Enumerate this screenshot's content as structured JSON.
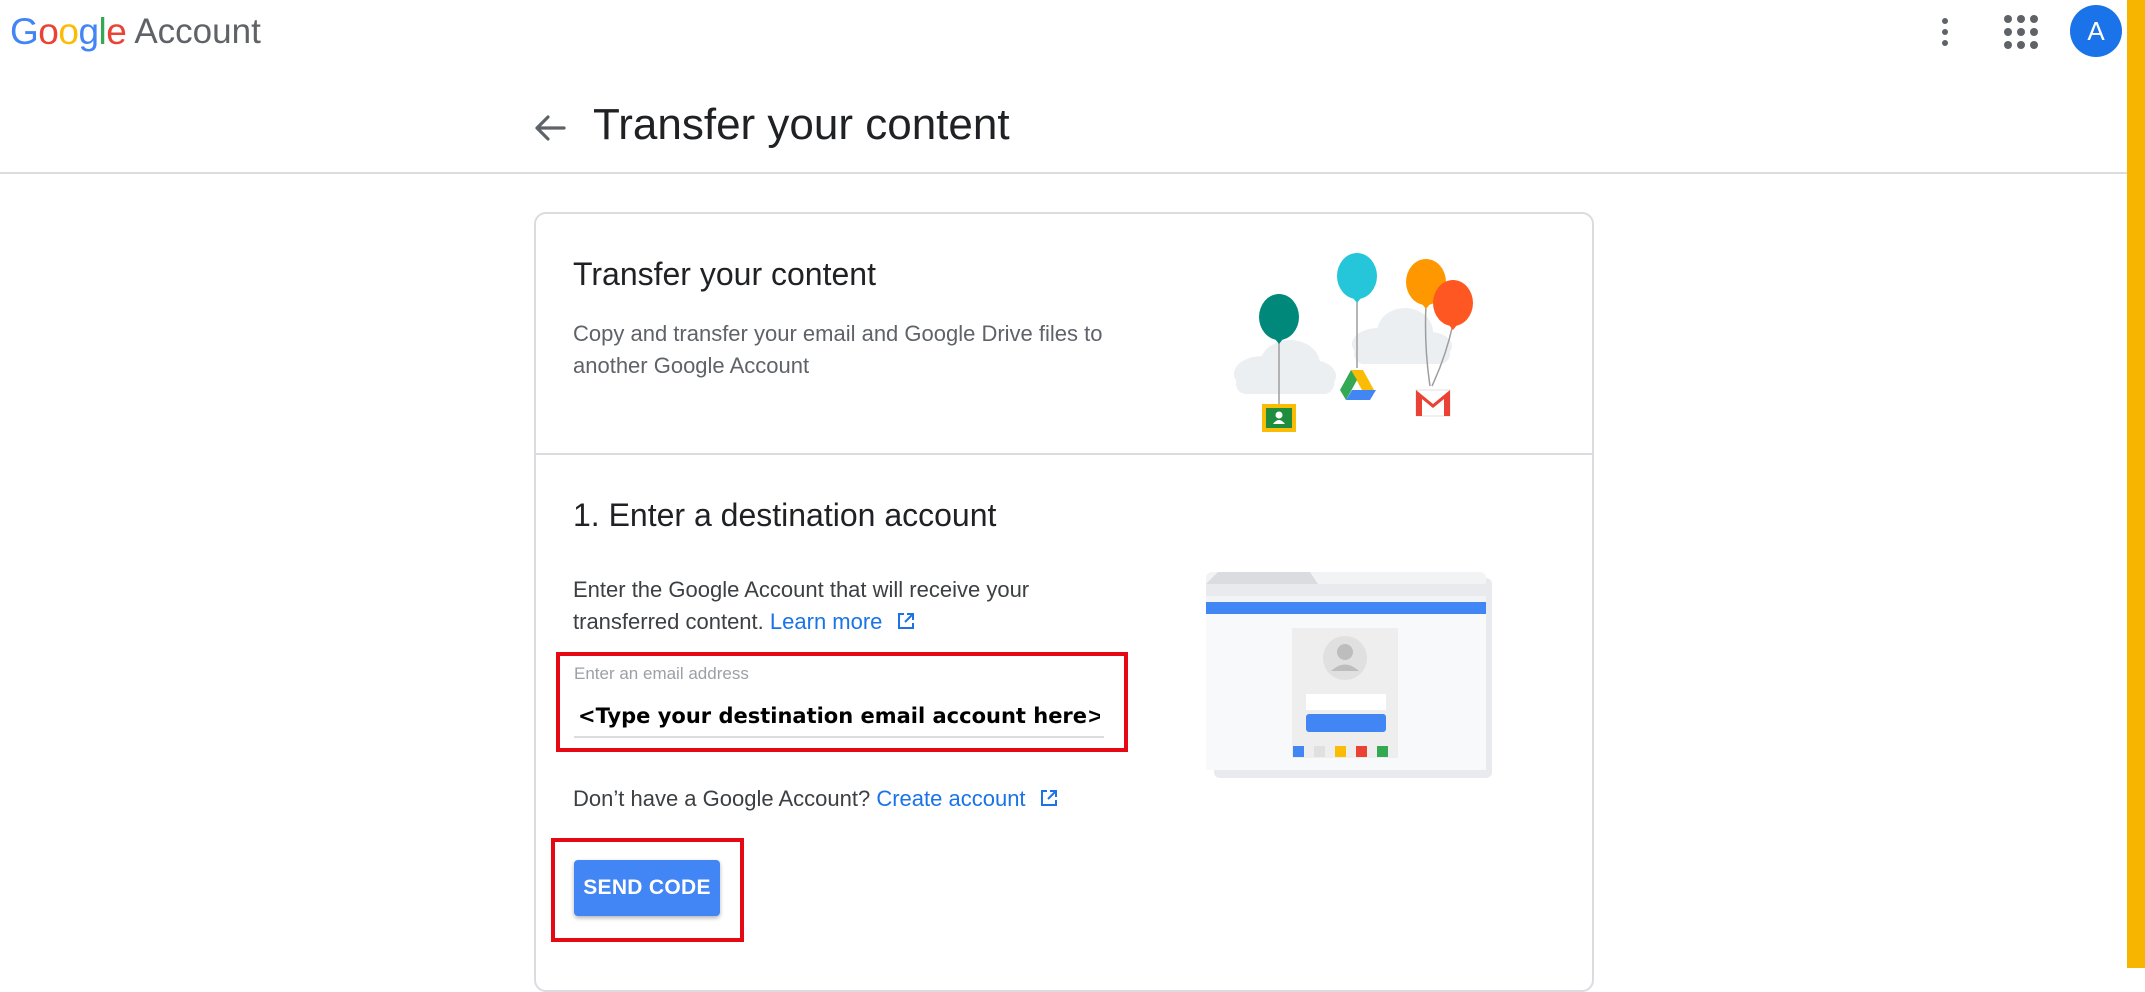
{
  "header": {
    "logo_google": "Google",
    "logo_account": "Account",
    "avatar_letter": "A",
    "icons": [
      "more-vert-icon",
      "apps-grid-icon"
    ]
  },
  "page": {
    "title": "Transfer your content",
    "back_icon": "arrow-back-icon"
  },
  "intro": {
    "title": "Transfer your content",
    "description": "Copy and transfer your email and Google Drive files to another Google Account",
    "illustration": "balloons-classroom-drive-gmail-illustration"
  },
  "step1": {
    "title": "1. Enter a destination account",
    "description": "Enter the Google Account that will receive your transferred content.",
    "learn_more": "Learn more",
    "email_label": "Enter an email address",
    "email_placeholder": "<Type your destination email account here>",
    "no_account_text": "Don’t have a Google Account?",
    "create_account": "Create account",
    "send_code": "SEND CODE",
    "illustration": "browser-account-sign-in-illustration"
  },
  "colors": {
    "google_blue": "#4285f4",
    "google_red": "#ea4335",
    "google_yellow": "#fbbc05",
    "google_green": "#34a853",
    "link_blue": "#1a73e8",
    "highlight_red": "#e50914",
    "side_bar_yellow": "#f7b500"
  }
}
